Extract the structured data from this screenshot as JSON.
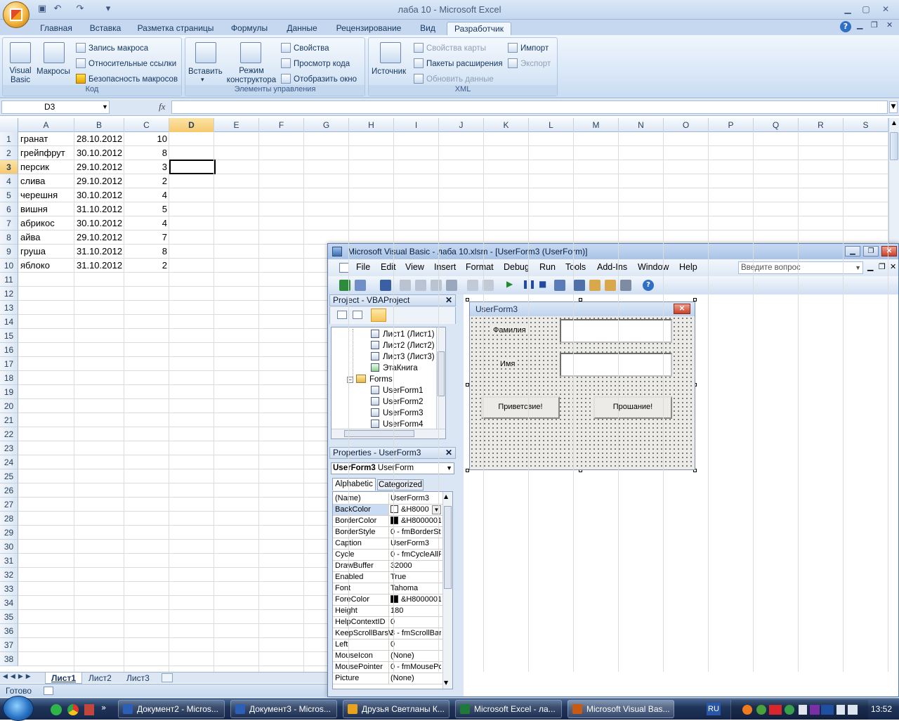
{
  "excel": {
    "title": "лаба 10 - Microsoft Excel",
    "tabs": [
      "Главная",
      "Вставка",
      "Разметка страницы",
      "Формулы",
      "Данные",
      "Рецензирование",
      "Вид",
      "Разработчик"
    ],
    "active_tab": "Разработчик",
    "groups": {
      "code": {
        "label": "Код",
        "visual_basic": "Visual Basic",
        "macros": "Макросы",
        "record_macro": "Запись макроса",
        "relative_refs": "Относительные ссылки",
        "macro_security": "Безопасность макросов"
      },
      "controls": {
        "label": "Элементы управления",
        "insert": "Вставить",
        "design_mode": "Режим конструктора",
        "properties": "Свойства",
        "view_code": "Просмотр кода",
        "show_window": "Отобразить окно"
      },
      "xml": {
        "label": "XML",
        "source": "Источник",
        "map_properties": "Свойства карты",
        "expansion_packs": "Пакеты расширения",
        "refresh_data": "Обновить данные",
        "import": "Импорт",
        "export": "Экспорт"
      }
    },
    "name_box": "D3",
    "fx": "fx",
    "columns": [
      "A",
      "B",
      "C",
      "D",
      "E",
      "F",
      "G",
      "H",
      "I",
      "J",
      "K",
      "L",
      "M",
      "N",
      "O",
      "P",
      "Q",
      "R",
      "S"
    ],
    "selected_column": "D",
    "rows": [
      "1",
      "2",
      "3",
      "4",
      "5",
      "6",
      "7",
      "8",
      "9",
      "10",
      "11",
      "12",
      "13",
      "14",
      "15",
      "16",
      "17",
      "18",
      "19",
      "20",
      "21",
      "22",
      "23",
      "24",
      "25",
      "26",
      "27",
      "28",
      "29",
      "30",
      "31",
      "32",
      "33",
      "34",
      "35",
      "36",
      "37",
      "38"
    ],
    "selected_row": "3",
    "data": [
      [
        "гранат",
        "28.10.2012",
        "10"
      ],
      [
        "грейпфрут",
        "30.10.2012",
        "8"
      ],
      [
        "персик",
        "29.10.2012",
        "3"
      ],
      [
        "слива",
        "29.10.2012",
        "2"
      ],
      [
        "черешня",
        "30.10.2012",
        "4"
      ],
      [
        "вишня",
        "31.10.2012",
        "5"
      ],
      [
        "абрикос",
        "30.10.2012",
        "4"
      ],
      [
        "айва",
        "29.10.2012",
        "7"
      ],
      [
        "груша",
        "31.10.2012",
        "8"
      ],
      [
        "яблоко",
        "31.10.2012",
        "2"
      ]
    ],
    "sheets": [
      "Лист1",
      "Лист2",
      "Лист3"
    ],
    "active_sheet": "Лист1",
    "status": "Готово"
  },
  "vb": {
    "title": "Microsoft Visual Basic - лаба 10.xlsm - [UserForm3 (UserForm)]",
    "menu": [
      "File",
      "Edit",
      "View",
      "Insert",
      "Format",
      "Debug",
      "Run",
      "Tools",
      "Add-Ins",
      "Window",
      "Help"
    ],
    "ask_placeholder": "Введите вопрос",
    "project": {
      "title": "Project - VBAProject",
      "items": [
        "Лист1 (Лист1)",
        "Лист2 (Лист2)",
        "Лист3 (Лист3)",
        "ЭтаКнига"
      ],
      "forms_folder": "Forms",
      "forms": [
        "UserForm1",
        "UserForm2",
        "UserForm3",
        "UserForm4"
      ]
    },
    "properties": {
      "title": "Properties - UserForm3",
      "object_name": "UserForm3",
      "object_type": "UserForm",
      "tabs": [
        "Alphabetic",
        "Categorized"
      ],
      "rows": [
        {
          "name": "(Name)",
          "value": "UserForm3",
          "swatch": ""
        },
        {
          "name": "BackColor",
          "value": "&H8000",
          "swatch": "#ffffff"
        },
        {
          "name": "BorderColor",
          "value": "&H8000001",
          "swatch": "#000000"
        },
        {
          "name": "BorderStyle",
          "value": "0 - fmBorderSt",
          "swatch": ""
        },
        {
          "name": "Caption",
          "value": "UserForm3",
          "swatch": ""
        },
        {
          "name": "Cycle",
          "value": "0 - fmCycleAllF",
          "swatch": ""
        },
        {
          "name": "DrawBuffer",
          "value": "32000",
          "swatch": ""
        },
        {
          "name": "Enabled",
          "value": "True",
          "swatch": ""
        },
        {
          "name": "Font",
          "value": "Tahoma",
          "swatch": ""
        },
        {
          "name": "ForeColor",
          "value": "&H8000001",
          "swatch": "#000000"
        },
        {
          "name": "Height",
          "value": "180",
          "swatch": ""
        },
        {
          "name": "HelpContextID",
          "value": "0",
          "swatch": ""
        },
        {
          "name": "KeepScrollBarsV",
          "value": "3 - fmScrollBar",
          "swatch": ""
        },
        {
          "name": "Left",
          "value": "0",
          "swatch": ""
        },
        {
          "name": "MouseIcon",
          "value": "(None)",
          "swatch": ""
        },
        {
          "name": "MousePointer",
          "value": "0 - fmMousePc",
          "swatch": ""
        },
        {
          "name": "Picture",
          "value": "(None)",
          "swatch": ""
        }
      ]
    },
    "userform": {
      "caption": "UserForm3",
      "label_surname": "Фамилия",
      "label_name": "Имя",
      "button_hello": "Приветсвие!",
      "button_bye": "Прошание!"
    }
  },
  "taskbar": {
    "items": [
      {
        "label": "Документ2 - Micros...",
        "color": "#2b5fb8"
      },
      {
        "label": "Документ3 - Micros...",
        "color": "#2b5fb8"
      },
      {
        "label": "Друзья Светланы К...",
        "color": "#e8a21c"
      },
      {
        "label": "Microsoft Excel - ла...",
        "color": "#1f7a3a"
      },
      {
        "label": "Microsoft Visual Bas...",
        "color": "#c85a12"
      }
    ],
    "lang": "RU",
    "clock": "13:52"
  }
}
